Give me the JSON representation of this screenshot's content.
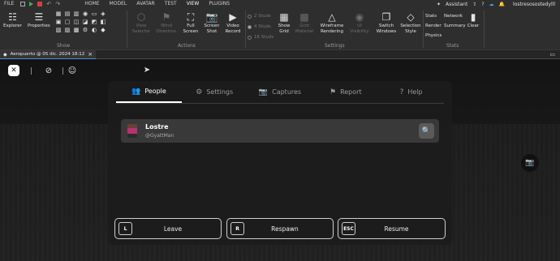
{
  "menubar": {
    "file": "FILE",
    "items": [
      "HOME",
      "MODEL",
      "AVATAR",
      "TEST",
      "VIEW",
      "PLUGINS"
    ],
    "active": "VIEW",
    "assistant": "Assistant",
    "username": "lostresosostedylll"
  },
  "ribbon": {
    "explorer": "Explorer",
    "properties": "Properties",
    "show_group": "Show",
    "view_selector": "View Selector",
    "wind_direction": "Wind Direction",
    "full_screen": "Full Screen",
    "screen_shot": "Screen Shot",
    "video_record": "Video Record",
    "actions_group": "Actions",
    "studs": [
      "2 Studs",
      "4 Studs",
      "16 Studs"
    ],
    "show_grid": "Show Grid",
    "grid_material": "Grid Material",
    "wireframe": "Wireframe Rendering",
    "ui_visibility": "UI Visibility",
    "switch_windows": "Switch Windows",
    "selection_style": "Selection Style",
    "settings_group": "Settings",
    "stats_col1": [
      "Stats",
      "Render",
      "Physics"
    ],
    "stats_col2": [
      "Network",
      "Summary"
    ],
    "clear": "Clear",
    "stats_group": "Stats"
  },
  "tab": {
    "title": "Aeropuerto @ 05 dic. 2024 18:12",
    "close": "×"
  },
  "overlay": {
    "tabs": [
      {
        "label": "People",
        "icon": "people-icon",
        "glyph": "👥"
      },
      {
        "label": "Settings",
        "icon": "gear-icon",
        "glyph": "⚙"
      },
      {
        "label": "Captures",
        "icon": "camera-icon",
        "glyph": "📷"
      },
      {
        "label": "Report",
        "icon": "flag-icon",
        "glyph": "⚑"
      },
      {
        "label": "Help",
        "icon": "help-icon",
        "glyph": "?"
      }
    ],
    "active_tab": "People",
    "player": {
      "display_name": "Lostre",
      "username": "@GyattMan"
    },
    "buttons": [
      {
        "key": "L",
        "label": "Leave"
      },
      {
        "key": "R",
        "label": "Respawn"
      },
      {
        "key": "ESC",
        "label": "Resume"
      }
    ]
  }
}
